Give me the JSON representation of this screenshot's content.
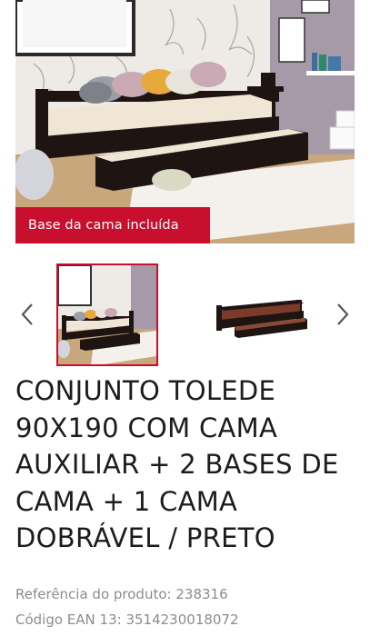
{
  "hero": {
    "badge": "Base da cama incluída",
    "alt": "Conjunto Tolede sofá-cama preto com cama auxiliar"
  },
  "gallery": {
    "prev_icon": "chevron-left-icon",
    "next_icon": "chevron-right-icon",
    "selected_index": 0,
    "accent_color": "#c8102e"
  },
  "product": {
    "title": "CONJUNTO TOLEDE 90X190 COM CAMA AUXILIAR + 2 BASES DE CAMA + 1 CAMA DOBRÁVEL / PRETO",
    "reference_label": "Referência do produto:",
    "reference_value": "238316",
    "ean_label": "Código EAN 13:",
    "ean_value": "3514230018072"
  }
}
